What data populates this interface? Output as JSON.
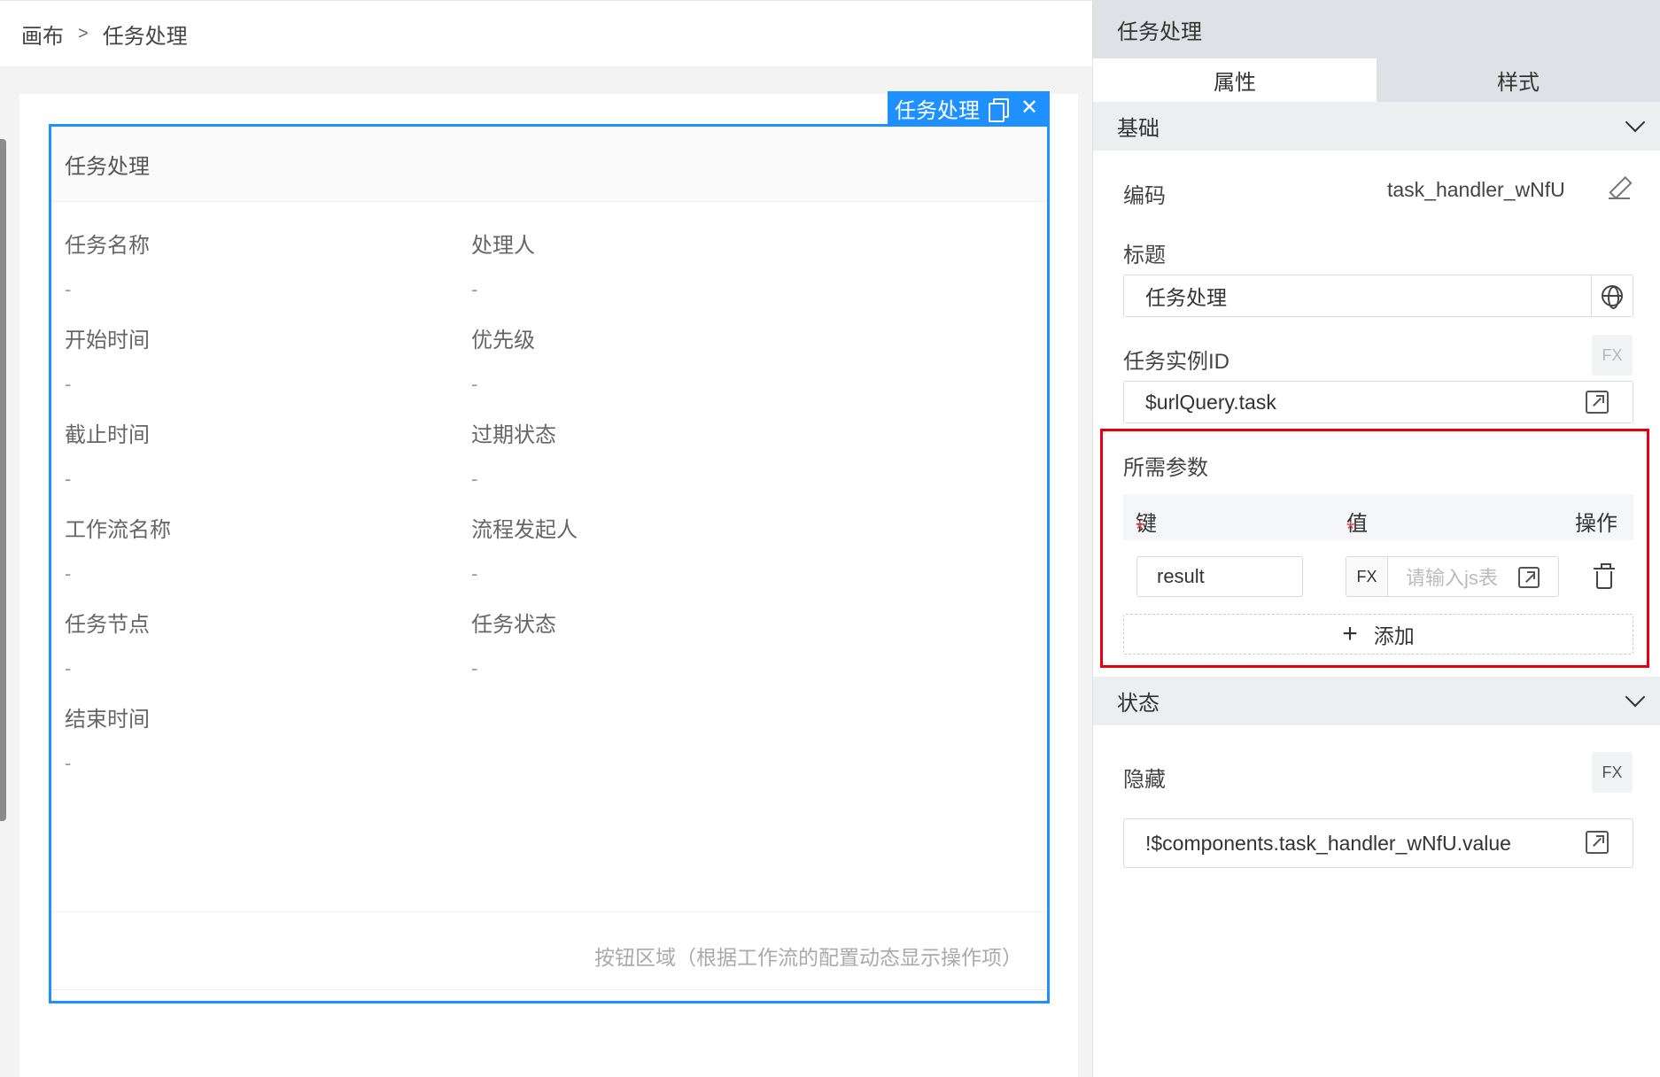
{
  "breadcrumb": {
    "root": "画布",
    "separator": ">",
    "current": "任务处理"
  },
  "canvas": {
    "tag_title": "任务处理",
    "card_title": "任务处理",
    "fields": [
      {
        "label": "任务名称",
        "value": "-"
      },
      {
        "label": "处理人",
        "value": "-"
      },
      {
        "label": "开始时间",
        "value": "-"
      },
      {
        "label": "优先级",
        "value": "-"
      },
      {
        "label": "截止时间",
        "value": "-"
      },
      {
        "label": "过期状态",
        "value": "-"
      },
      {
        "label": "工作流名称",
        "value": "-"
      },
      {
        "label": "流程发起人",
        "value": "-"
      },
      {
        "label": "任务节点",
        "value": "-"
      },
      {
        "label": "任务状态",
        "value": "-"
      },
      {
        "label": "结束时间",
        "value": "-"
      }
    ],
    "footer_text": "按钮区域（根据工作流的配置动态显示操作项）"
  },
  "panel": {
    "title": "任务处理",
    "tabs": [
      "属性",
      "样式"
    ],
    "basic": {
      "section_title": "基础",
      "code_label": "编码",
      "code_value": "task_handler_wNfU",
      "title_label": "标题",
      "title_value": "任务处理",
      "task_id_label": "任务实例ID",
      "task_id_fx": "FX",
      "task_id_value": "$urlQuery.task",
      "params_label": "所需参数",
      "params_header": {
        "key": "键",
        "value": "值",
        "action": "操作"
      },
      "params": [
        {
          "key": "result",
          "fx": "FX",
          "value_placeholder": "请输入js表"
        }
      ],
      "add_label": "添加"
    },
    "state": {
      "section_title": "状态",
      "hidden_label": "隐藏",
      "hidden_fx": "FX",
      "hidden_value": "!$components.task_handler_wNfU.value"
    }
  },
  "colors": {
    "accent": "#1e90ff",
    "highlight": "#e60012",
    "required": "#e5484d"
  }
}
